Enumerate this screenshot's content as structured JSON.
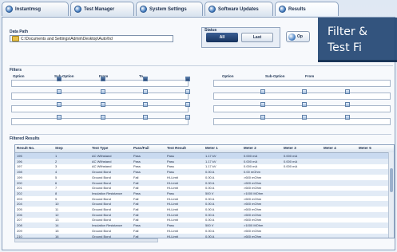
{
  "tabs": [
    {
      "label": "Instantmsg"
    },
    {
      "label": "Test Manager"
    },
    {
      "label": "System Settings"
    },
    {
      "label": "Software Updates"
    },
    {
      "label": "Results"
    }
  ],
  "data_path": {
    "label": "Data Path",
    "value": "C:\\Documents and Settings\\Admin\\Desktop\\Auto\\hd"
  },
  "status": {
    "label": "Status",
    "all_label": "All",
    "last_label": "Last"
  },
  "open_button": {
    "label": "Op"
  },
  "filters": {
    "label": "Filters",
    "columns": [
      "Option",
      "Sub-Option",
      "From",
      "To"
    ],
    "columns_right": [
      "Option",
      "Sub-Option",
      "From"
    ]
  },
  "results": {
    "label": "Filtered Results",
    "columns": [
      "Result No.",
      "Step",
      "Test Type",
      "Pass/Fail",
      "Test Result",
      "Meter 1",
      "Meter 2",
      "Meter 3",
      "Meter 4",
      "Meter 5"
    ],
    "rows": [
      [
        "195",
        "1",
        "AC Withstand",
        "Pass",
        "Pass",
        "1.17 kV",
        "0.000 mA",
        "0.000 mA",
        "",
        ""
      ],
      [
        "196",
        "2",
        "AC Withstand",
        "Pass",
        "Pass",
        "1.17 kV",
        "0.000 mA",
        "0.000 mA",
        "",
        ""
      ],
      [
        "197",
        "3",
        "AC Withstand",
        "Pass",
        "Pass",
        "1.17 kV",
        "0.000 mA",
        "0.000 mA",
        "",
        ""
      ],
      [
        "198",
        "4",
        "Ground Bond",
        "Pass",
        "Pass",
        "0.00 A",
        "0.00 mOhm",
        "",
        "",
        ""
      ],
      [
        "199",
        "5",
        "Ground Bond",
        "Fail",
        "HI-Limit",
        "0.00 A",
        ">600 mOhm",
        "",
        "",
        ""
      ],
      [
        "200",
        "6",
        "Ground Bond",
        "Fail",
        "HI-Limit",
        "0.00 A",
        ">600 mOhm",
        "",
        "",
        ""
      ],
      [
        "201",
        "7",
        "Ground Bond",
        "Fail",
        "HI-Limit",
        "0.00 A",
        ">600 mOhm",
        "",
        "",
        ""
      ],
      [
        "202",
        "8",
        "Insulation Resistance",
        "Pass",
        "Pass",
        "500 V",
        ">1000 MOhm",
        "",
        "",
        ""
      ],
      [
        "203",
        "9",
        "Ground Bond",
        "Fail",
        "HI-Limit",
        "0.00 A",
        ">600 mOhm",
        "",
        "",
        ""
      ],
      [
        "204",
        "10",
        "Ground Bond",
        "Fail",
        "HI-Limit",
        "0.00 A",
        ">600 mOhm",
        "",
        "",
        ""
      ],
      [
        "205",
        "11",
        "Ground Bond",
        "Fail",
        "HI-Limit",
        "0.00 A",
        ">600 mOhm",
        "",
        "",
        ""
      ],
      [
        "206",
        "12",
        "Ground Bond",
        "Fail",
        "HI-Limit",
        "0.00 A",
        ">600 mOhm",
        "",
        "",
        ""
      ],
      [
        "207",
        "13",
        "Ground Bond",
        "Fail",
        "HI-Limit",
        "0.00 A",
        ">600 mOhm",
        "",
        "",
        ""
      ],
      [
        "208",
        "14",
        "Insulation Resistance",
        "Pass",
        "Pass",
        "500 V",
        ">1000 MOhm",
        "",
        "",
        ""
      ],
      [
        "209",
        "15",
        "Ground Bond",
        "Fail",
        "HI-Limit",
        "0.00 A",
        ">600 mOhm",
        "",
        "",
        ""
      ],
      [
        "210",
        "16",
        "Ground Bond",
        "Fail",
        "HI-Limit",
        "0.00 A",
        ">600 mOhm",
        "",
        "",
        ""
      ]
    ]
  },
  "overlay": {
    "line1": "Filter &",
    "line2": "Test Fi"
  },
  "colors": {
    "accent": "#224573",
    "row_alt": "#e2ebf6"
  }
}
